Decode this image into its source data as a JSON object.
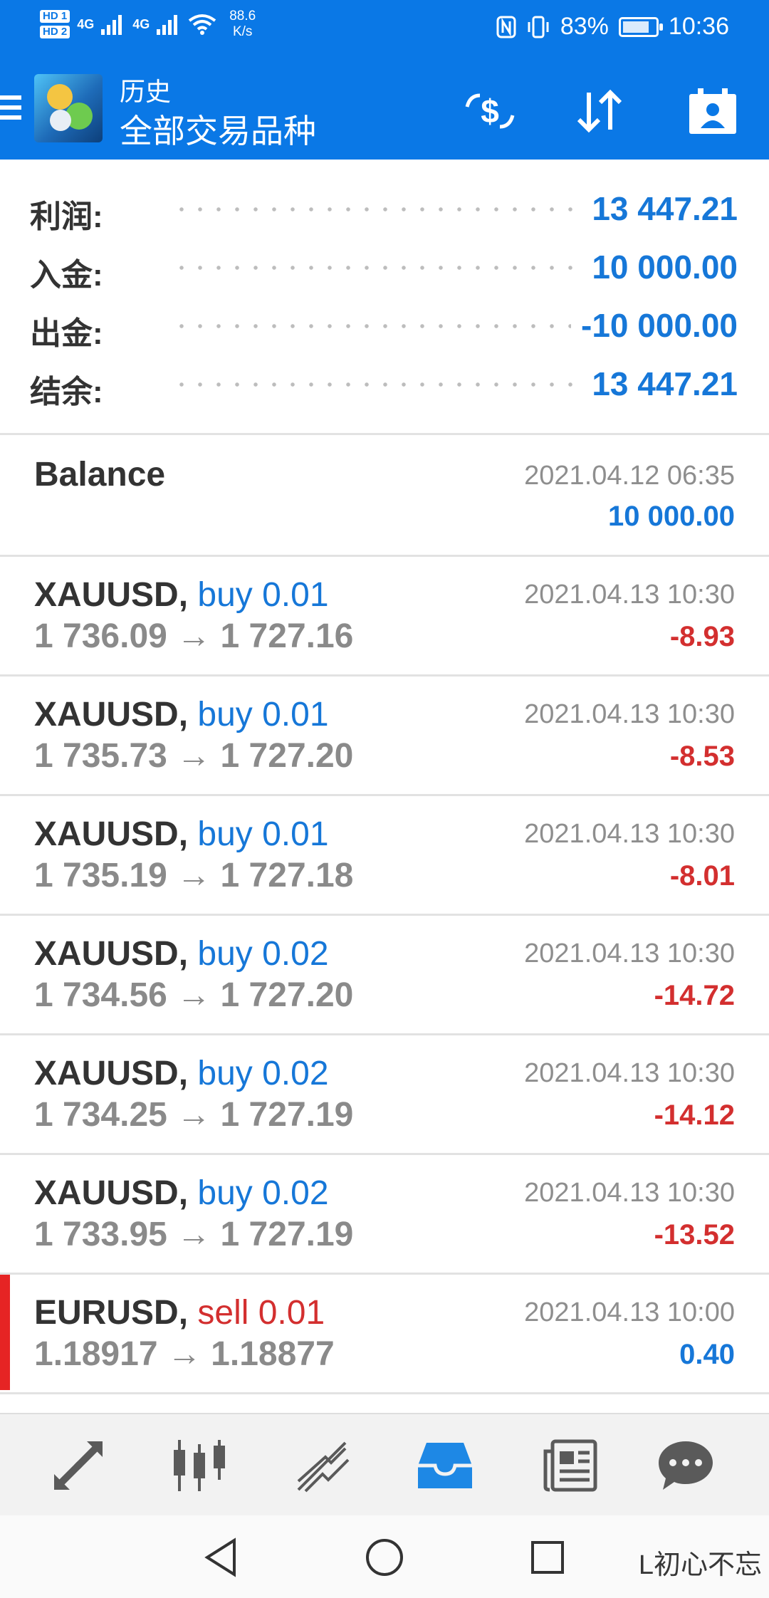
{
  "status_bar": {
    "sim1": "HD 1",
    "sim2": "HD 2",
    "net1": "4G",
    "net2": "4G",
    "speed_value": "88.6",
    "speed_unit": "K/s",
    "battery": "83%",
    "battery_level": 0.83,
    "time": "10:36"
  },
  "header": {
    "subtitle": "历史",
    "title": "全部交易品种"
  },
  "summary": [
    {
      "label": "利润:",
      "value": "13 447.21"
    },
    {
      "label": "入金:",
      "value": "10 000.00"
    },
    {
      "label": "出金:",
      "value": "-10 000.00"
    },
    {
      "label": "结余:",
      "value": "13 447.21"
    }
  ],
  "balance": {
    "label": "Balance",
    "time": "2021.04.12 06:35",
    "amount": "10 000.00"
  },
  "deals": [
    {
      "symbol": "XAUUSD,",
      "direction": "buy 0.01",
      "prices": "1 736.09 → 1 727.16",
      "time": "2021.04.13 10:30",
      "profit": "-8.93"
    },
    {
      "symbol": "XAUUSD,",
      "direction": "buy 0.01",
      "prices": "1 735.73 → 1 727.20",
      "time": "2021.04.13 10:30",
      "profit": "-8.53"
    },
    {
      "symbol": "XAUUSD,",
      "direction": "buy 0.01",
      "prices": "1 735.19 → 1 727.18",
      "time": "2021.04.13 10:30",
      "profit": "-8.01"
    },
    {
      "symbol": "XAUUSD,",
      "direction": "buy 0.02",
      "prices": "1 734.56 → 1 727.20",
      "time": "2021.04.13 10:30",
      "profit": "-14.72"
    },
    {
      "symbol": "XAUUSD,",
      "direction": "buy 0.02",
      "prices": "1 734.25 → 1 727.19",
      "time": "2021.04.13 10:30",
      "profit": "-14.12"
    },
    {
      "symbol": "XAUUSD,",
      "direction": "buy 0.02",
      "prices": "1 733.95 → 1 727.19",
      "time": "2021.04.13 10:30",
      "profit": "-13.52"
    },
    {
      "symbol": "EURUSD,",
      "direction": "sell 0.01",
      "prices": "1.18917 → 1.18877",
      "time": "2021.04.13 10:00",
      "profit": "0.40"
    }
  ],
  "tabs": [
    {
      "icon": "quotes-arrows-icon"
    },
    {
      "icon": "candlestick-chart-icon"
    },
    {
      "icon": "trade-line-icon"
    },
    {
      "icon": "history-inbox-icon",
      "active": true
    },
    {
      "icon": "news-icon"
    },
    {
      "icon": "chat-icon"
    }
  ],
  "watermark": "L初心不忘",
  "colors": {
    "primary": "#0a78e6",
    "profit_positive": "#1677d8",
    "profit_negative": "#d32f2f",
    "sell_marker": "#e62424"
  }
}
